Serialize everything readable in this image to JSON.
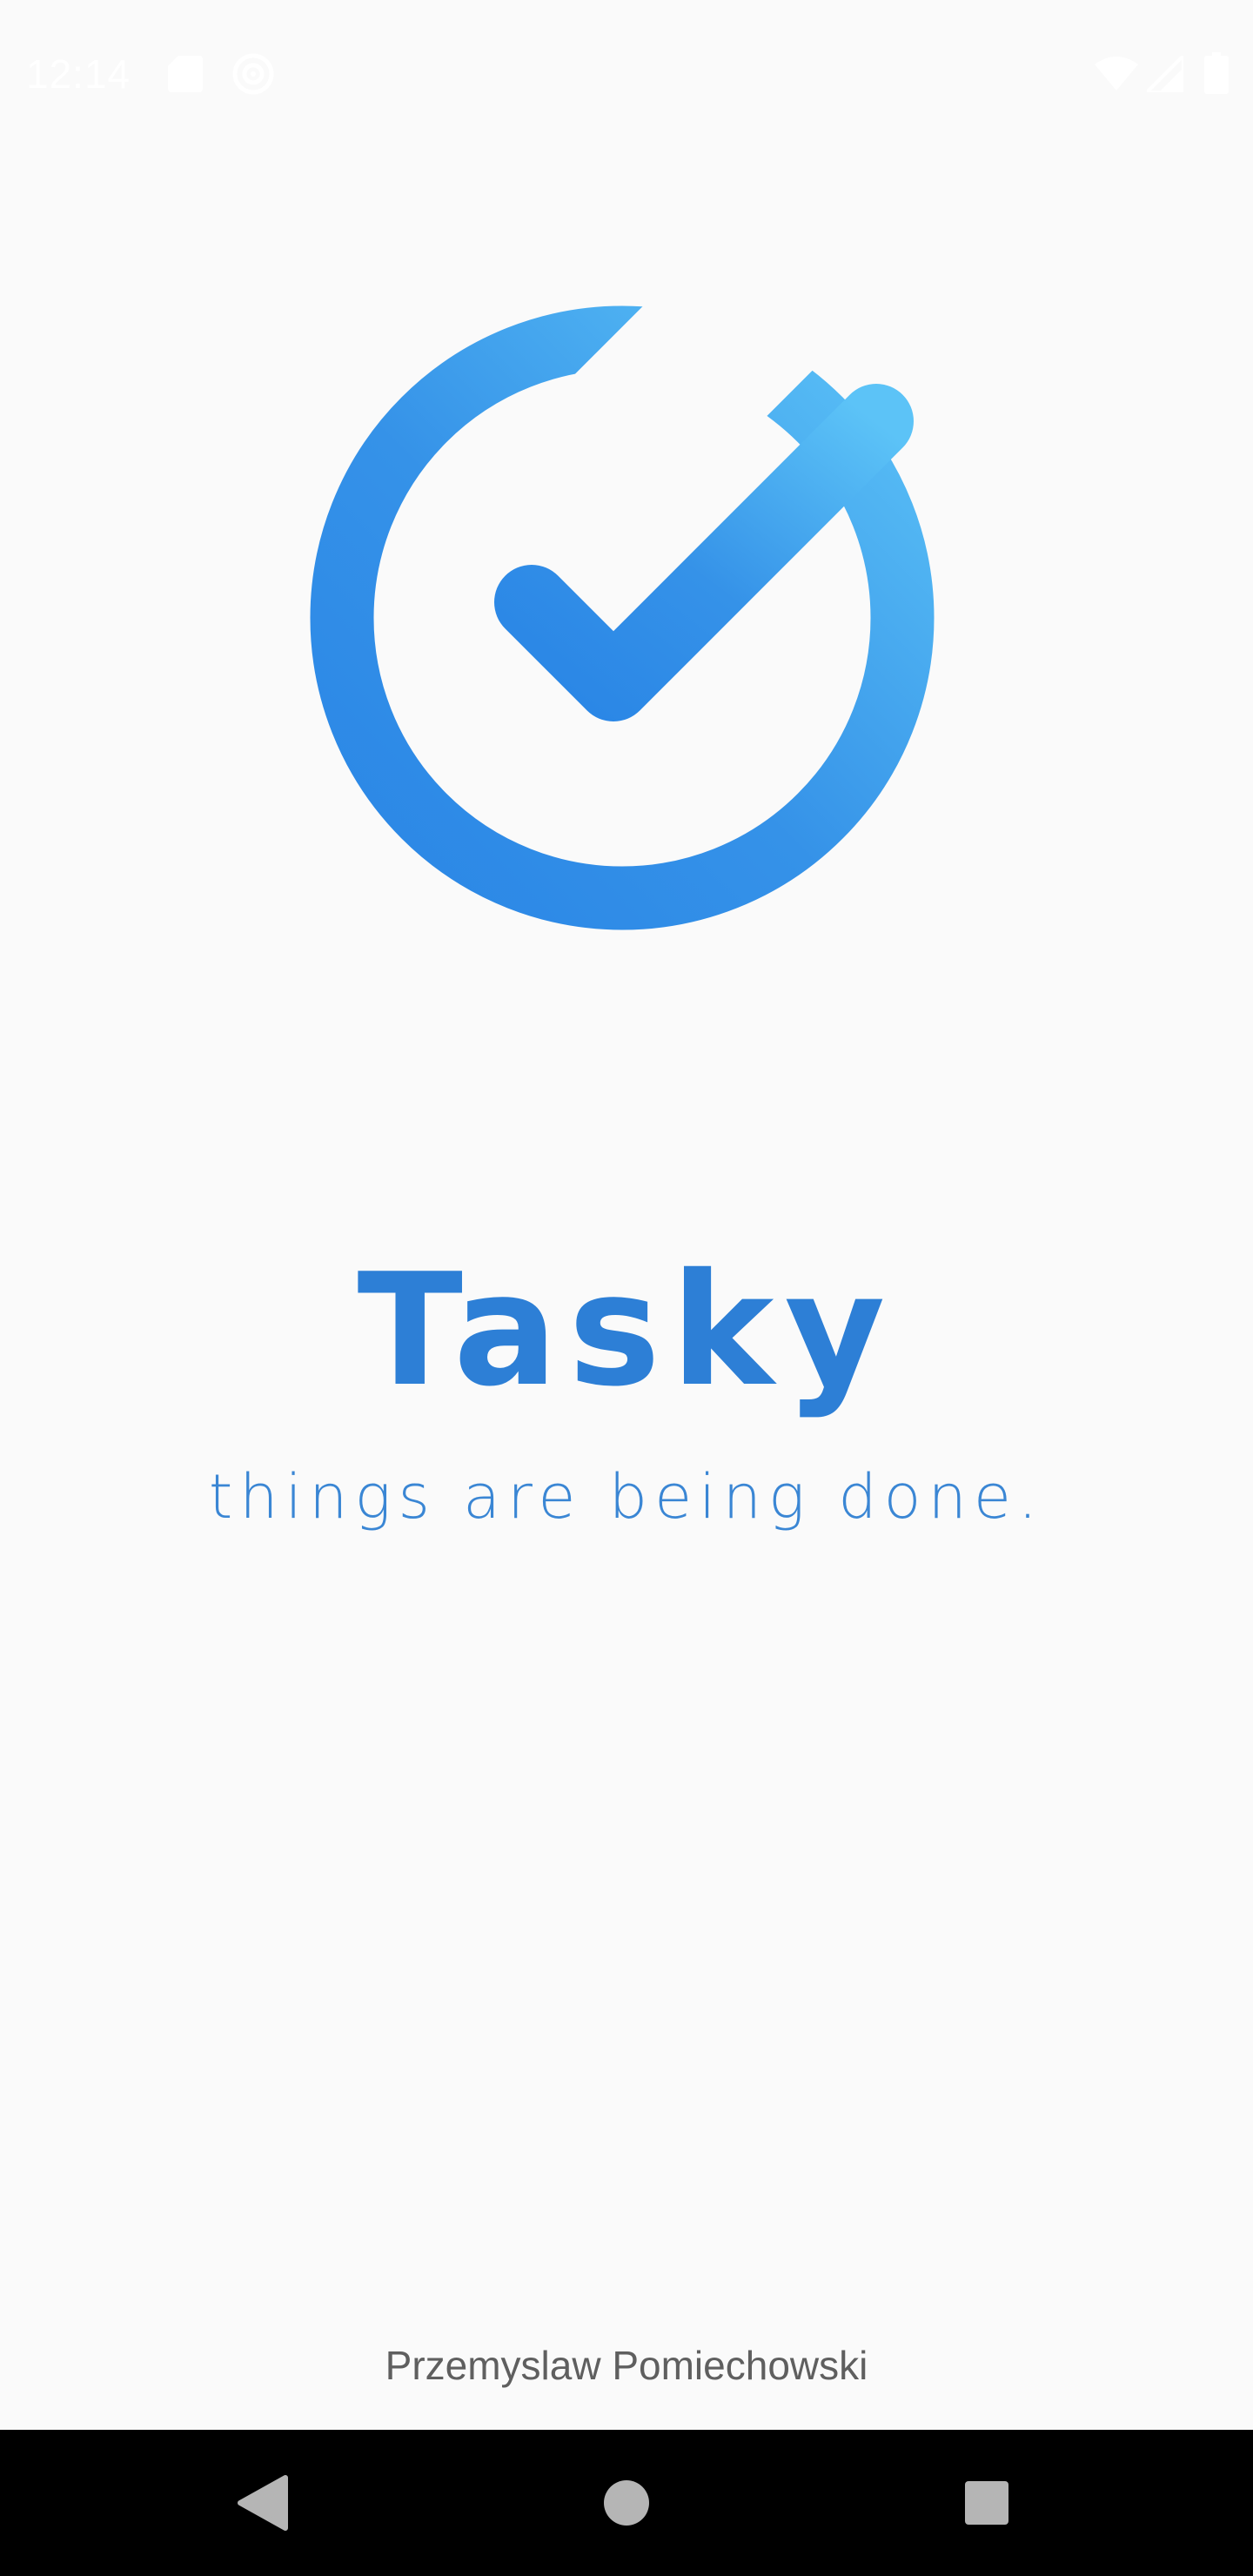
{
  "status_bar": {
    "time": "12:14",
    "icons": [
      "sd-card-icon",
      "sync-icon",
      "wifi-icon",
      "cell-signal-icon",
      "battery-icon"
    ]
  },
  "logo": {
    "icon": "check-circle-logo-icon",
    "gradient_start": "#2a86e6",
    "gradient_end": "#5cc3f7"
  },
  "app": {
    "name": "Tasky",
    "tagline": "things are being done."
  },
  "footer": {
    "author": "Przemyslaw Pomiechowski"
  },
  "nav_bar": {
    "buttons": [
      "back-icon",
      "home-icon",
      "recents-icon"
    ]
  },
  "colors": {
    "background": "#fafafa",
    "brand_blue": "#2d7fd6",
    "nav_bar": "#000000"
  }
}
